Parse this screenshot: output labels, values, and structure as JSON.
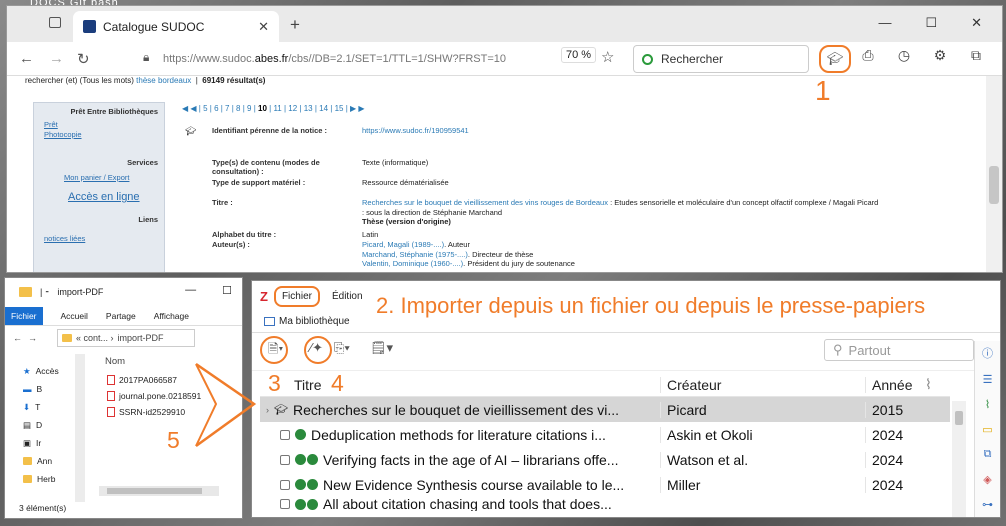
{
  "desktop": {
    "top_text": "DOCS    Git bash"
  },
  "browser": {
    "tab_title": "Catalogue SUDOC",
    "new_tab": "+",
    "url_prefix": "https://www.sudoc.",
    "url_host": "abes.fr",
    "url_path": "/cbs//DB=2.1/SET=1/TTL=1/SHW?FRST=10",
    "zoom": "70 %",
    "search_placeholder": "Rechercher",
    "annotation": "1"
  },
  "sudoc": {
    "breadcrumb_prefix": "rechercher (et) (Tous les mots)",
    "breadcrumb_link": "thèse bordeaux",
    "result_count": "69149 résultat(s)",
    "sidebar": {
      "pret_header": "Prêt Entre Bibliothèques",
      "pret": "Prêt",
      "photocopie": "Photocopie",
      "services_header": "Services",
      "panier": "Mon panier / Export",
      "acces": "Accès en ligne",
      "liens_header": "Liens",
      "notices": "notices liées"
    },
    "pager": {
      "first": "◀",
      "prev": "◀",
      "p5": "5",
      "p6": "6",
      "p7": "7",
      "p8": "8",
      "p9": "9",
      "p10": "10",
      "p11": "11",
      "p12": "12",
      "p13": "13",
      "p14": "14",
      "p15": "15",
      "next": "▶",
      "last": "▶"
    },
    "record": {
      "id_label": "Identifiant pérenne de la notice :",
      "id_value": "https://www.sudoc.fr/190959541",
      "type_label": "Type(s) de contenu (modes de consultation) :",
      "type_value": "Texte (informatique)",
      "support_label": "Type de support matériel :",
      "support_value": "Ressource dématérialisée",
      "titre_label": "Titre :",
      "titre_link": "Recherches sur le bouquet de vieillissement des vins rouges de Bordeaux",
      "titre_rest": ": Etudes sensorielle et moléculaire d'un concept olfactif complexe / Magali Picard",
      "titre_line2": ": sous la direction de Stéphanie Marchand",
      "titre_line3": "Thèse (version d'origine)",
      "alphabet_label": "Alphabet du titre :",
      "alphabet_value": "Latin",
      "auteurs_label": "Auteur(s) :",
      "auteur1": "Picard, Magali (1989-....)",
      "auteur1_role": ". Auteur",
      "auteur2": "Marchand, Stéphanie (1975-....)",
      "auteur2_role": ". Directeur de thèse",
      "auteur3": "Valentin, Dominique (1960-....)",
      "auteur3_role": ". Président du jury de soutenance"
    }
  },
  "explorer": {
    "title": "import-PDF",
    "ribbon": [
      "Fichier",
      "Accueil",
      "Partage",
      "Affichage"
    ],
    "address_prefix": "«  cont...  ›",
    "address_folder": "import-PDF",
    "sidebar": [
      "Accès",
      "B",
      "T",
      "D",
      "Ir",
      "Ann",
      "Herb"
    ],
    "column": "Nom",
    "files": [
      "2017PA066587",
      "journal.pone.0218591",
      "SSRN-id2529910"
    ],
    "status": "3 élément(s)"
  },
  "zotero": {
    "menu_fichier": "Fichier",
    "menu_edition": "Édition",
    "library": "Ma bibliothèque",
    "search_placeholder": "Partout",
    "columns": {
      "title": "Titre",
      "creator": "Créateur",
      "year": "Année"
    },
    "rows": [
      {
        "title": "Recherches sur le bouquet de vieillissement des vi...",
        "creator": "Picard",
        "year": "2015"
      },
      {
        "title": "Deduplication methods for literature citations i...",
        "creator": "Askin et Okoli",
        "year": "2024"
      },
      {
        "title": "Verifying facts in the age of AI – librarians offe...",
        "creator": "Watson et al.",
        "year": "2024"
      },
      {
        "title": "New Evidence Synthesis course available to le...",
        "creator": "Miller",
        "year": "2024"
      },
      {
        "title": "All about citation chasing and tools that does...",
        "creator": "",
        "year": ""
      }
    ]
  },
  "annotations": {
    "a2": "2. Importer depuis un fichier ou depuis le presse-papiers",
    "a3": "3",
    "a4": "4",
    "a5": "5"
  },
  "colors": {
    "accent": "#f07c2a",
    "zotero_red": "#d7262f",
    "link": "#2a7ab5"
  }
}
